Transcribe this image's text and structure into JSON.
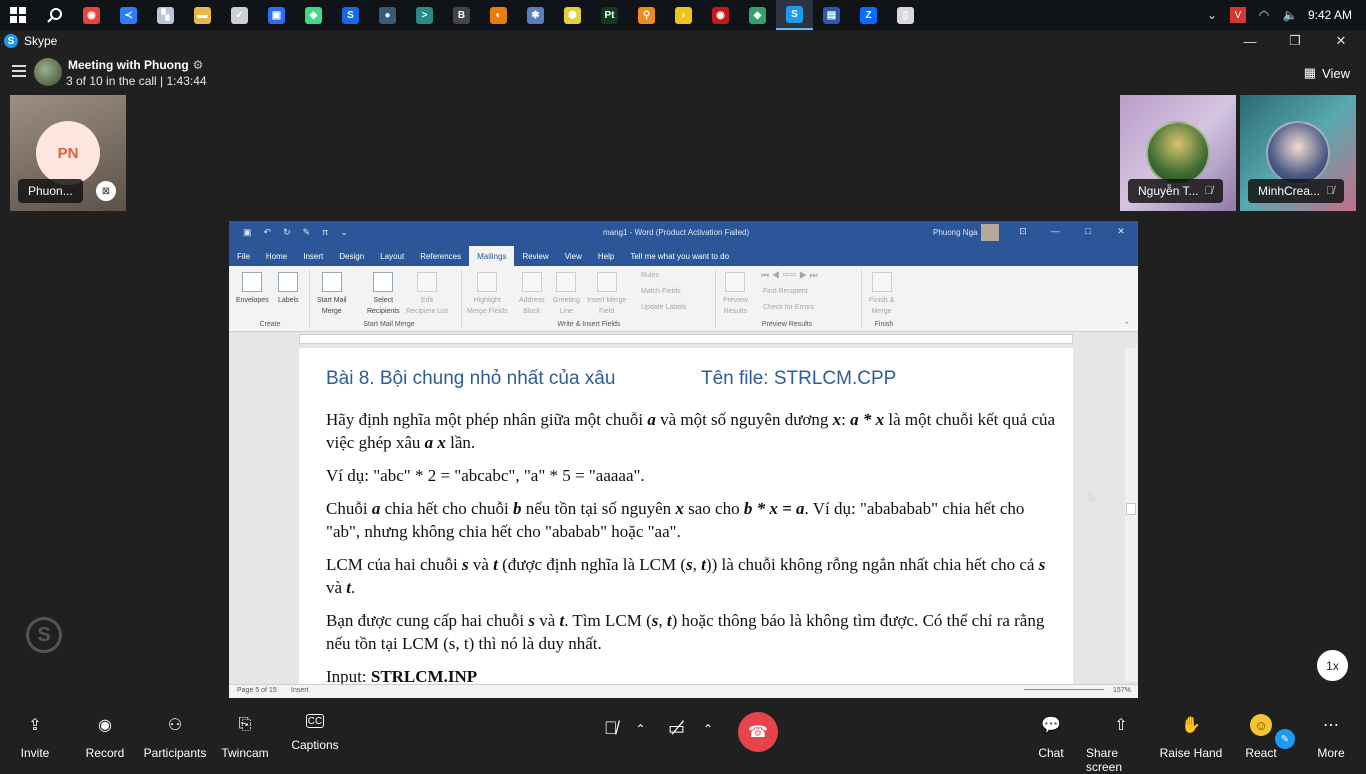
{
  "taskbar": {
    "pinned": [
      {
        "name": "chrome-icon",
        "glyph": "◉",
        "color": "#e8453c"
      },
      {
        "name": "vscode-icon",
        "glyph": "≺",
        "color": "#2d7ff9"
      },
      {
        "name": "app-icon",
        "glyph": "▚",
        "color": "#b9c6d8"
      },
      {
        "name": "folder-icon",
        "glyph": "▬",
        "color": "#e7b84a"
      },
      {
        "name": "check-icon",
        "glyph": "✓",
        "color": "#cfcfcf"
      },
      {
        "name": "app-blue-icon",
        "glyph": "▣",
        "color": "#2f6cf5"
      },
      {
        "name": "android-icon",
        "glyph": "◆",
        "color": "#3ddc84"
      },
      {
        "name": "app-square-icon",
        "glyph": "S",
        "color": "#1668e8"
      },
      {
        "name": "steam-icon",
        "glyph": "●",
        "color": "#3b5a7a"
      },
      {
        "name": "terminal-icon",
        "glyph": ">",
        "color": "#2a8a8a"
      },
      {
        "name": "bitcoin-icon",
        "glyph": "B",
        "color": "#444"
      },
      {
        "name": "blender-icon",
        "glyph": "◐",
        "color": "#e87d0d"
      },
      {
        "name": "settings-app-icon",
        "glyph": "✱",
        "color": "#5b7dbd"
      },
      {
        "name": "hex-icon",
        "glyph": "⬢",
        "color": "#e3d03a"
      },
      {
        "name": "pt-icon",
        "glyph": "Pt",
        "color": "#0e3b1f"
      },
      {
        "name": "search-app-icon",
        "glyph": "⚲",
        "color": "#f08a1c"
      },
      {
        "name": "duck-icon",
        "glyph": "◗",
        "color": "#f0c419"
      },
      {
        "name": "record-icon",
        "glyph": "◉",
        "color": "#c01a1a"
      },
      {
        "name": "diamond-icon",
        "glyph": "◆",
        "color": "#2fa56c"
      },
      {
        "name": "skype-icon",
        "glyph": "S",
        "color": "#1d9bf0"
      },
      {
        "name": "chart-app-icon",
        "glyph": "▤",
        "color": "#2a5ba8"
      },
      {
        "name": "zalo-icon",
        "glyph": "Z",
        "color": "#0a6cff"
      },
      {
        "name": "document-icon",
        "glyph": "▯",
        "color": "#d8d8d8"
      }
    ],
    "time": "9:42 AM"
  },
  "skype": {
    "app_title": "Skype"
  },
  "meeting": {
    "title": "Meeting with Phuong",
    "subtitle": "3 of 10 in the call | 1:43:44",
    "view_label": "View"
  },
  "participants": {
    "pn": {
      "initials": "PN",
      "name": "Phuon..."
    },
    "ng": {
      "name": "Nguyễn T..."
    },
    "mc": {
      "name": "MinhCrea..."
    }
  },
  "word": {
    "doc_title": "mang1 - Word (Product Activation Failed)",
    "user": "Phuong Nga",
    "tabs": [
      "File",
      "Home",
      "Insert",
      "Design",
      "Layout",
      "References",
      "Mailings",
      "Review",
      "View",
      "Help"
    ],
    "tell_me": "Tell me what you want to do",
    "ribbon": {
      "envelopes": "Envelopes",
      "labels": "Labels",
      "create": "Create",
      "start_mail_merge_1": "Start Mail",
      "start_mail_merge_2": "Merge",
      "select_recipients_1": "Select",
      "select_recipients_2": "Recipients",
      "edit_recipient_1": "Edit",
      "edit_recipient_2": "Recipient List",
      "group_start": "Start Mail Merge",
      "highlight_1": "Highlight",
      "highlight_2": "Merge Fields",
      "address_1": "Address",
      "address_2": "Block",
      "greeting_1": "Greeting",
      "greeting_2": "Line",
      "insert_merge_1": "Insert Merge",
      "insert_merge_2": "Field",
      "rules": "Rules",
      "match_fields": "Match Fields",
      "update_labels": "Update Labels",
      "group_write": "Write & Insert Fields",
      "preview_1": "Preview",
      "preview_2": "Results",
      "find_recipient": "Find Recipient",
      "check_errors": "Check for Errors",
      "group_preview": "Preview Results",
      "finish_1": "Finish &",
      "finish_2": "Merge",
      "group_finish": "Finish"
    },
    "heading_left": "Bài 8. Bội chung nhỏ nhất của xâu",
    "heading_right": "Tên file: STRLCM.CPP",
    "status_page": "Page 5 of 15",
    "status_mode": "Insert",
    "zoom": "157%"
  },
  "toolbar": {
    "invite": "Invite",
    "record": "Record",
    "participants": "Participants",
    "twincam": "Twincam",
    "captions": "Captions",
    "chat": "Chat",
    "share_screen": "Share screen",
    "raise_hand": "Raise Hand",
    "react": "React",
    "more": "More",
    "speed": "1x"
  }
}
